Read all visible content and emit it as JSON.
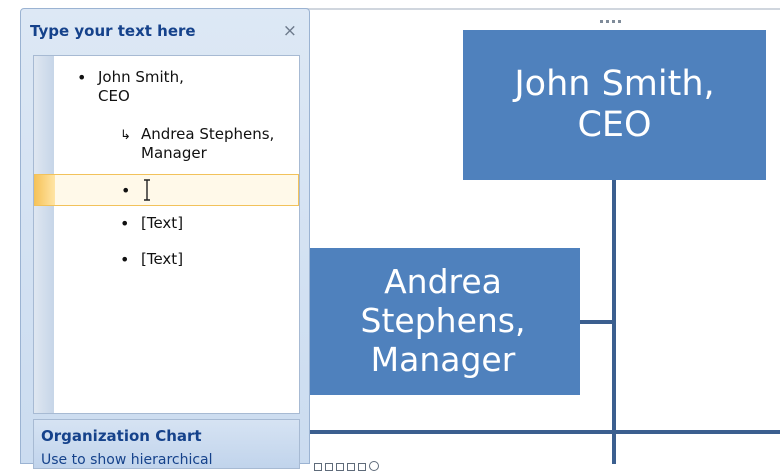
{
  "pane": {
    "title": "Type your text here",
    "close_glyph": "×",
    "items": [
      {
        "bullet": "•",
        "text": "John Smith,\nCEO"
      },
      {
        "bullet": "↳",
        "text": "Andrea Stephens,\nManager"
      },
      {
        "bullet": "•",
        "text": ""
      },
      {
        "bullet": "•",
        "text": "[Text]"
      },
      {
        "bullet": "•",
        "text": "[Text]"
      }
    ],
    "info": {
      "title": "Organization Chart",
      "description": "Use to show hierarchical"
    }
  },
  "chart": {
    "ceo_box_text": "John Smith,\nCEO",
    "manager_box_text": "Andrea\nStephens,\nManager",
    "box_color": "#4f81bd",
    "connector_color": "#3b5f8f"
  },
  "icons": {
    "close": "close-icon",
    "text-cursor": "text-cursor-icon",
    "resize-grip": "resize-grip-icon"
  }
}
